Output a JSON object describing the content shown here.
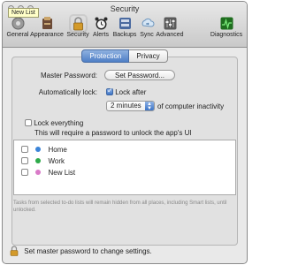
{
  "window": {
    "title": "Security"
  },
  "tooltip": "New List",
  "toolbar": {
    "items": [
      {
        "label": "General",
        "icon": "general-icon",
        "color": "#8a8a8a"
      },
      {
        "label": "Appearance",
        "icon": "appearance-icon",
        "color": "#5a3a2a"
      },
      {
        "label": "Security",
        "icon": "lock-icon",
        "color": "#c48a1a"
      },
      {
        "label": "Alerts",
        "icon": "alarm-clock-icon",
        "color": "#333333"
      },
      {
        "label": "Backups",
        "icon": "backups-icon",
        "color": "#4a6aa0"
      },
      {
        "label": "Sync",
        "icon": "sync-icon",
        "color": "#7aa2c8"
      },
      {
        "label": "Advanced",
        "icon": "advanced-icon",
        "color": "#555555"
      },
      {
        "label": "Diagnostics",
        "icon": "diagnostics-icon",
        "color": "#2f8a2f"
      }
    ]
  },
  "tabs": {
    "protection": "Protection",
    "privacy": "Privacy"
  },
  "master_password": {
    "label": "Master Password:",
    "button": "Set Password..."
  },
  "auto_lock": {
    "label": "Automatically lock:",
    "checkbox_label": "Lock after",
    "checked": true,
    "duration": "2 minutes",
    "suffix": "of computer inactivity"
  },
  "lock_everything": {
    "label": "Lock everything",
    "description": "This will require a password to unlock the app's UI"
  },
  "lists": [
    {
      "name": "Home",
      "color": "#3b84d8"
    },
    {
      "name": "Work",
      "color": "#2eaa4a"
    },
    {
      "name": "New List",
      "color": "#d97ac8"
    }
  ],
  "footnote": "Tasks from selected to-do lists will remain hidden from all places, including Smart lists, until unlocked.",
  "lock_message": "Set master password to change settings."
}
